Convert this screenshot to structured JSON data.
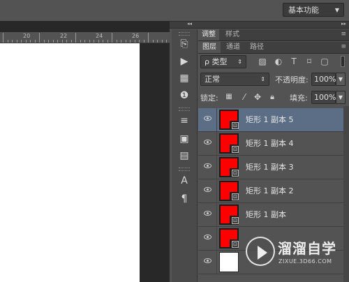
{
  "topbar": {
    "workspace_label": "基本功能",
    "workspace_arrow": "chevron-down-icon"
  },
  "ruler": {
    "labels": [
      "20",
      "22",
      "24",
      "26"
    ]
  },
  "tabs_adjust": {
    "items": [
      "调整",
      "样式"
    ],
    "active": 0
  },
  "tabs_layers": {
    "items": [
      "图层",
      "通道",
      "路径"
    ],
    "active": 0
  },
  "filter": {
    "kind_label": "ρ 类型"
  },
  "blend": {
    "mode": "正常",
    "opacity_label": "不透明度:",
    "opacity_value": "100%"
  },
  "lock": {
    "lock_label": "锁定:",
    "fill_label": "填充:",
    "fill_value": "100%"
  },
  "layers": [
    {
      "name": "矩形 1 副本 5",
      "selected": true,
      "type": "shape",
      "color": "#ff0000"
    },
    {
      "name": "矩形 1 副本 4",
      "selected": false,
      "type": "shape",
      "color": "#ff0000"
    },
    {
      "name": "矩形 1 副本 3",
      "selected": false,
      "type": "shape",
      "color": "#ff0000"
    },
    {
      "name": "矩形 1 副本 2",
      "selected": false,
      "type": "shape",
      "color": "#ff0000"
    },
    {
      "name": "矩形 1 副本",
      "selected": false,
      "type": "shape",
      "color": "#ff0000"
    },
    {
      "name": "",
      "selected": false,
      "type": "shape",
      "color": "#ff0000"
    },
    {
      "name": "",
      "selected": false,
      "type": "background",
      "color": "#ffffff"
    }
  ],
  "watermark": {
    "title": "溜溜自学",
    "subtitle": "ZIXUE.3D66.COM"
  },
  "colors": {
    "accent_selected": "#5b6e86",
    "panel": "#535353",
    "dark": "#282828"
  }
}
